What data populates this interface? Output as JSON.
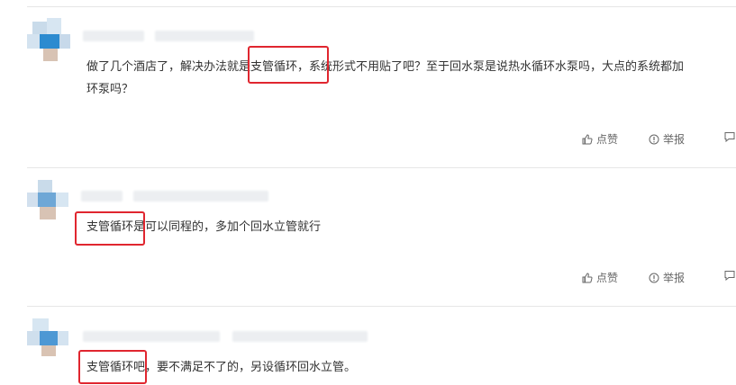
{
  "comments": [
    {
      "text_line1": "做了几个酒店了，解决办法就是支管循环，系统形式不用贴了吧？至于回水泵是说热水循环水泵吗，大点的系统都加",
      "text_line2": "环泵吗？",
      "like_label": "点赞",
      "report_label": "举报"
    },
    {
      "text_line1": "支管循环是可以同程的，多加个回水立管就行",
      "like_label": "点赞",
      "report_label": "举报"
    },
    {
      "text_line1": "支管循环吧，要不满足不了的，另设循环回水立管。"
    }
  ],
  "colors": {
    "highlight_box": "#e0262f",
    "divider": "#e6e6e6",
    "action_text": "#666666"
  },
  "icons": [
    "thumb-up-icon",
    "report-icon",
    "comment-icon"
  ]
}
